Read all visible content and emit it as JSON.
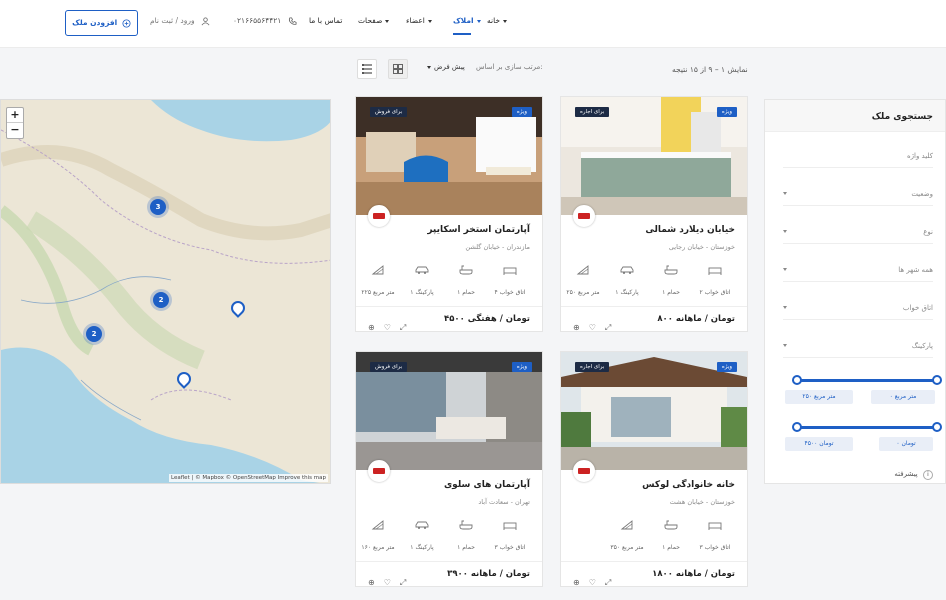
{
  "header": {
    "nav": [
      {
        "label": "خانه",
        "dropdown": true
      },
      {
        "label": "املاک",
        "dropdown": true,
        "active": true
      },
      {
        "label": "اعضاء",
        "dropdown": true
      },
      {
        "label": "صفحات",
        "dropdown": true
      },
      {
        "label": "تماس با ما",
        "dropdown": false
      }
    ],
    "phone": "۰۲۱۶۶۵۵۶۴۴۲۱",
    "login": "ورود / ثبت نام",
    "add_property": "افزودن ملک"
  },
  "results": {
    "count_text": "نمایش ۱ – ۹ از ۱۵ نتیجه",
    "sort_label": "مرتب سازی بر اساس:",
    "sort_value": "پیش فرض"
  },
  "map": {
    "zoom_in": "+",
    "zoom_out": "−",
    "attribution": "Leaflet | © Mapbox © OpenStreetMap Improve this map",
    "clusters": [
      "3",
      "2",
      "2"
    ]
  },
  "cards": [
    {
      "title": "خیابان دیلارد شمالی",
      "address": "خوزستان - خیابان رجایی",
      "status": "برای اجاره",
      "featured": "ویژه",
      "beds": "۲ اتاق خواب",
      "baths": "۱ حمام",
      "parking": "۱ پارکینگ",
      "area": "۲۵۰ متر مربع",
      "price": "۸۰۰ تومان / ماهانه"
    },
    {
      "title": "آپارتمان استخر اسکایپر",
      "address": "مازندران - خیابان گلشن",
      "status": "برای فروش",
      "featured": "ویژه",
      "beds": "۴ اتاق خواب",
      "baths": "۱ حمام",
      "parking": "۱ پارکینگ",
      "area": "۲۲۵ متر مربع",
      "price": "۴۵۰۰ تومان / هفتگی"
    },
    {
      "title": "خانه خانوادگی لوکس",
      "address": "خوزستان - خیابان هشت",
      "status": "برای اجاره",
      "featured": "ویژه",
      "beds": "۳ اتاق خواب",
      "baths": "۱ حمام",
      "parking": "",
      "area": "۳۵۰ متر مربع",
      "price": "۱۸۰۰ تومان / ماهانه"
    },
    {
      "title": "آپارتمان های سلوی",
      "address": "تهران - سعادت آباد",
      "status": "برای فروش",
      "featured": "ویژه",
      "beds": "۳ اتاق خواب",
      "baths": "۱ حمام",
      "parking": "۱ پارکینگ",
      "area": "۱۶۰ متر مربع",
      "price": "۳۹۰۰ تومان / ماهانه"
    }
  ],
  "search": {
    "title": "جستجوی ملک",
    "keyword": "کلید واژه",
    "status": "وضعیت",
    "type": "نوع",
    "cities": "همه شهر ها",
    "bedrooms": "اتاق خواب",
    "parking": "پارکینگ",
    "area_min": "۰ متر مربع",
    "area_max": "۲۵۰ متر مربع",
    "price_min": "۰ تومان",
    "price_max": "۴۵۰۰ تومان",
    "advanced": "پیشرفته"
  },
  "colors": {
    "accent": "#1e5fc5",
    "dark_tag": "#1d2b45"
  }
}
